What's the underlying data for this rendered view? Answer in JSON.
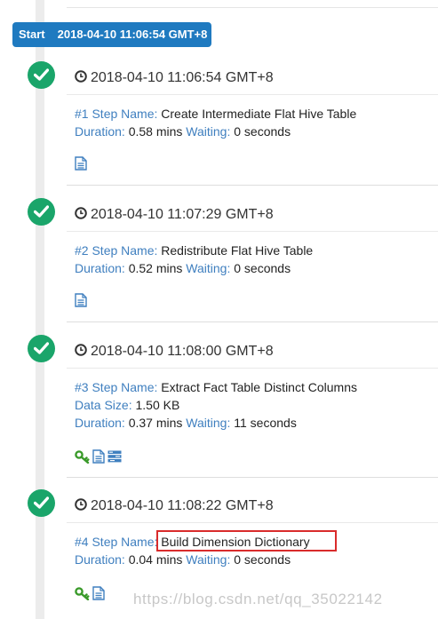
{
  "start": {
    "label": "Start",
    "timestamp": "2018-04-10 11:06:54 GMT+8"
  },
  "steps": [
    {
      "timestamp": "2018-04-10 11:06:54 GMT+8",
      "step_key": "#1 Step Name:",
      "step_name": "Create Intermediate Flat Hive Table",
      "duration_key": "Duration:",
      "duration": "0.58 mins",
      "waiting_key": "Waiting:",
      "waiting": "0 seconds",
      "icons": [
        "log-file-icon"
      ]
    },
    {
      "timestamp": "2018-04-10 11:07:29 GMT+8",
      "step_key": "#2 Step Name:",
      "step_name": "Redistribute Flat Hive Table",
      "duration_key": "Duration:",
      "duration": "0.52 mins",
      "waiting_key": "Waiting:",
      "waiting": "0 seconds",
      "icons": [
        "log-file-icon"
      ]
    },
    {
      "timestamp": "2018-04-10 11:08:00 GMT+8",
      "step_key": "#3 Step Name:",
      "step_name": "Extract Fact Table Distinct Columns",
      "data_size_key": "Data Size:",
      "data_size": "1.50 KB",
      "duration_key": "Duration:",
      "duration": "0.37 mins",
      "waiting_key": "Waiting:",
      "waiting": "11 seconds",
      "icons": [
        "key-icon",
        "log-file-icon",
        "tasks-icon"
      ]
    },
    {
      "timestamp": "2018-04-10 11:08:22 GMT+8",
      "step_key": "#4 Step Name:",
      "step_name": "Build Dimension Dictionary",
      "duration_key": "Duration:",
      "duration": "0.04 mins",
      "waiting_key": "Waiting:",
      "waiting": "0 seconds",
      "icons": [
        "key-icon",
        "log-file-icon"
      ]
    }
  ],
  "watermark": "https://blog.csdn.net/qq_35022142",
  "colors": {
    "accent": "#1f7ac0",
    "success": "#1aa56a",
    "link": "#3f7fbf",
    "highlight": "#d92b2b"
  }
}
